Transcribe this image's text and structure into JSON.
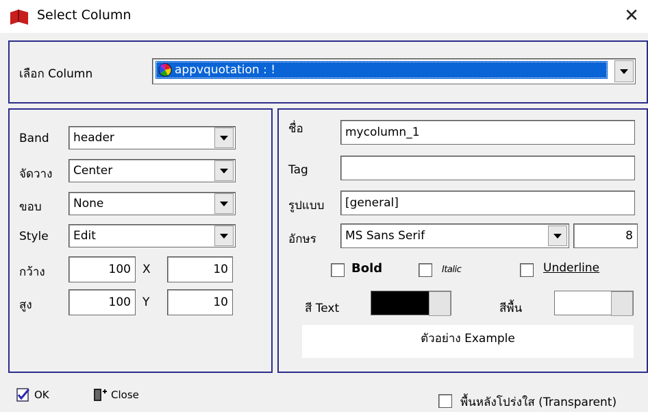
{
  "window": {
    "title": "Select Column",
    "app_icon": "red-book-icon",
    "close_glyph": "✕"
  },
  "column_select": {
    "label": "เลือก Column",
    "selected": "appvquotation : !",
    "item_icon": "color-wheel-icon"
  },
  "left_panel": {
    "band_label": "Band",
    "band_value": "header",
    "align_label": "จัดวาง",
    "align_value": "Center",
    "border_label": "ขอบ",
    "border_value": "None",
    "style_label": "Style",
    "style_value": "Edit",
    "width_label": "กว้าง",
    "width_value": "100",
    "x_label": "X",
    "x_value": "10",
    "height_label": "สูง",
    "height_value": "100",
    "y_label": "Y",
    "y_value": "10"
  },
  "right_panel": {
    "name_label": "ชื่อ",
    "name_value": "mycolumn_1",
    "tag_label": "Tag",
    "tag_value": "",
    "format_label": "รูปแบบ",
    "format_value": "[general]",
    "font_label": "อักษร",
    "font_value": "MS Sans Serif",
    "font_size": "8",
    "bold_label": "Bold",
    "italic_label": "Italic",
    "underline_label": "Underline",
    "text_color_label": "สี Text",
    "text_color": "#000000",
    "bg_color_label": "สีพื้น",
    "bg_color": "#ffffff",
    "example_text": "ตัวอย่าง Example"
  },
  "footer": {
    "ok_label": "OK",
    "close_label": "Close",
    "transparent_label": "พื้นหลังโปร่งใส (Transparent)"
  },
  "colors": {
    "panel_border": "#2c2c8c",
    "selection": "#0a64d6"
  }
}
